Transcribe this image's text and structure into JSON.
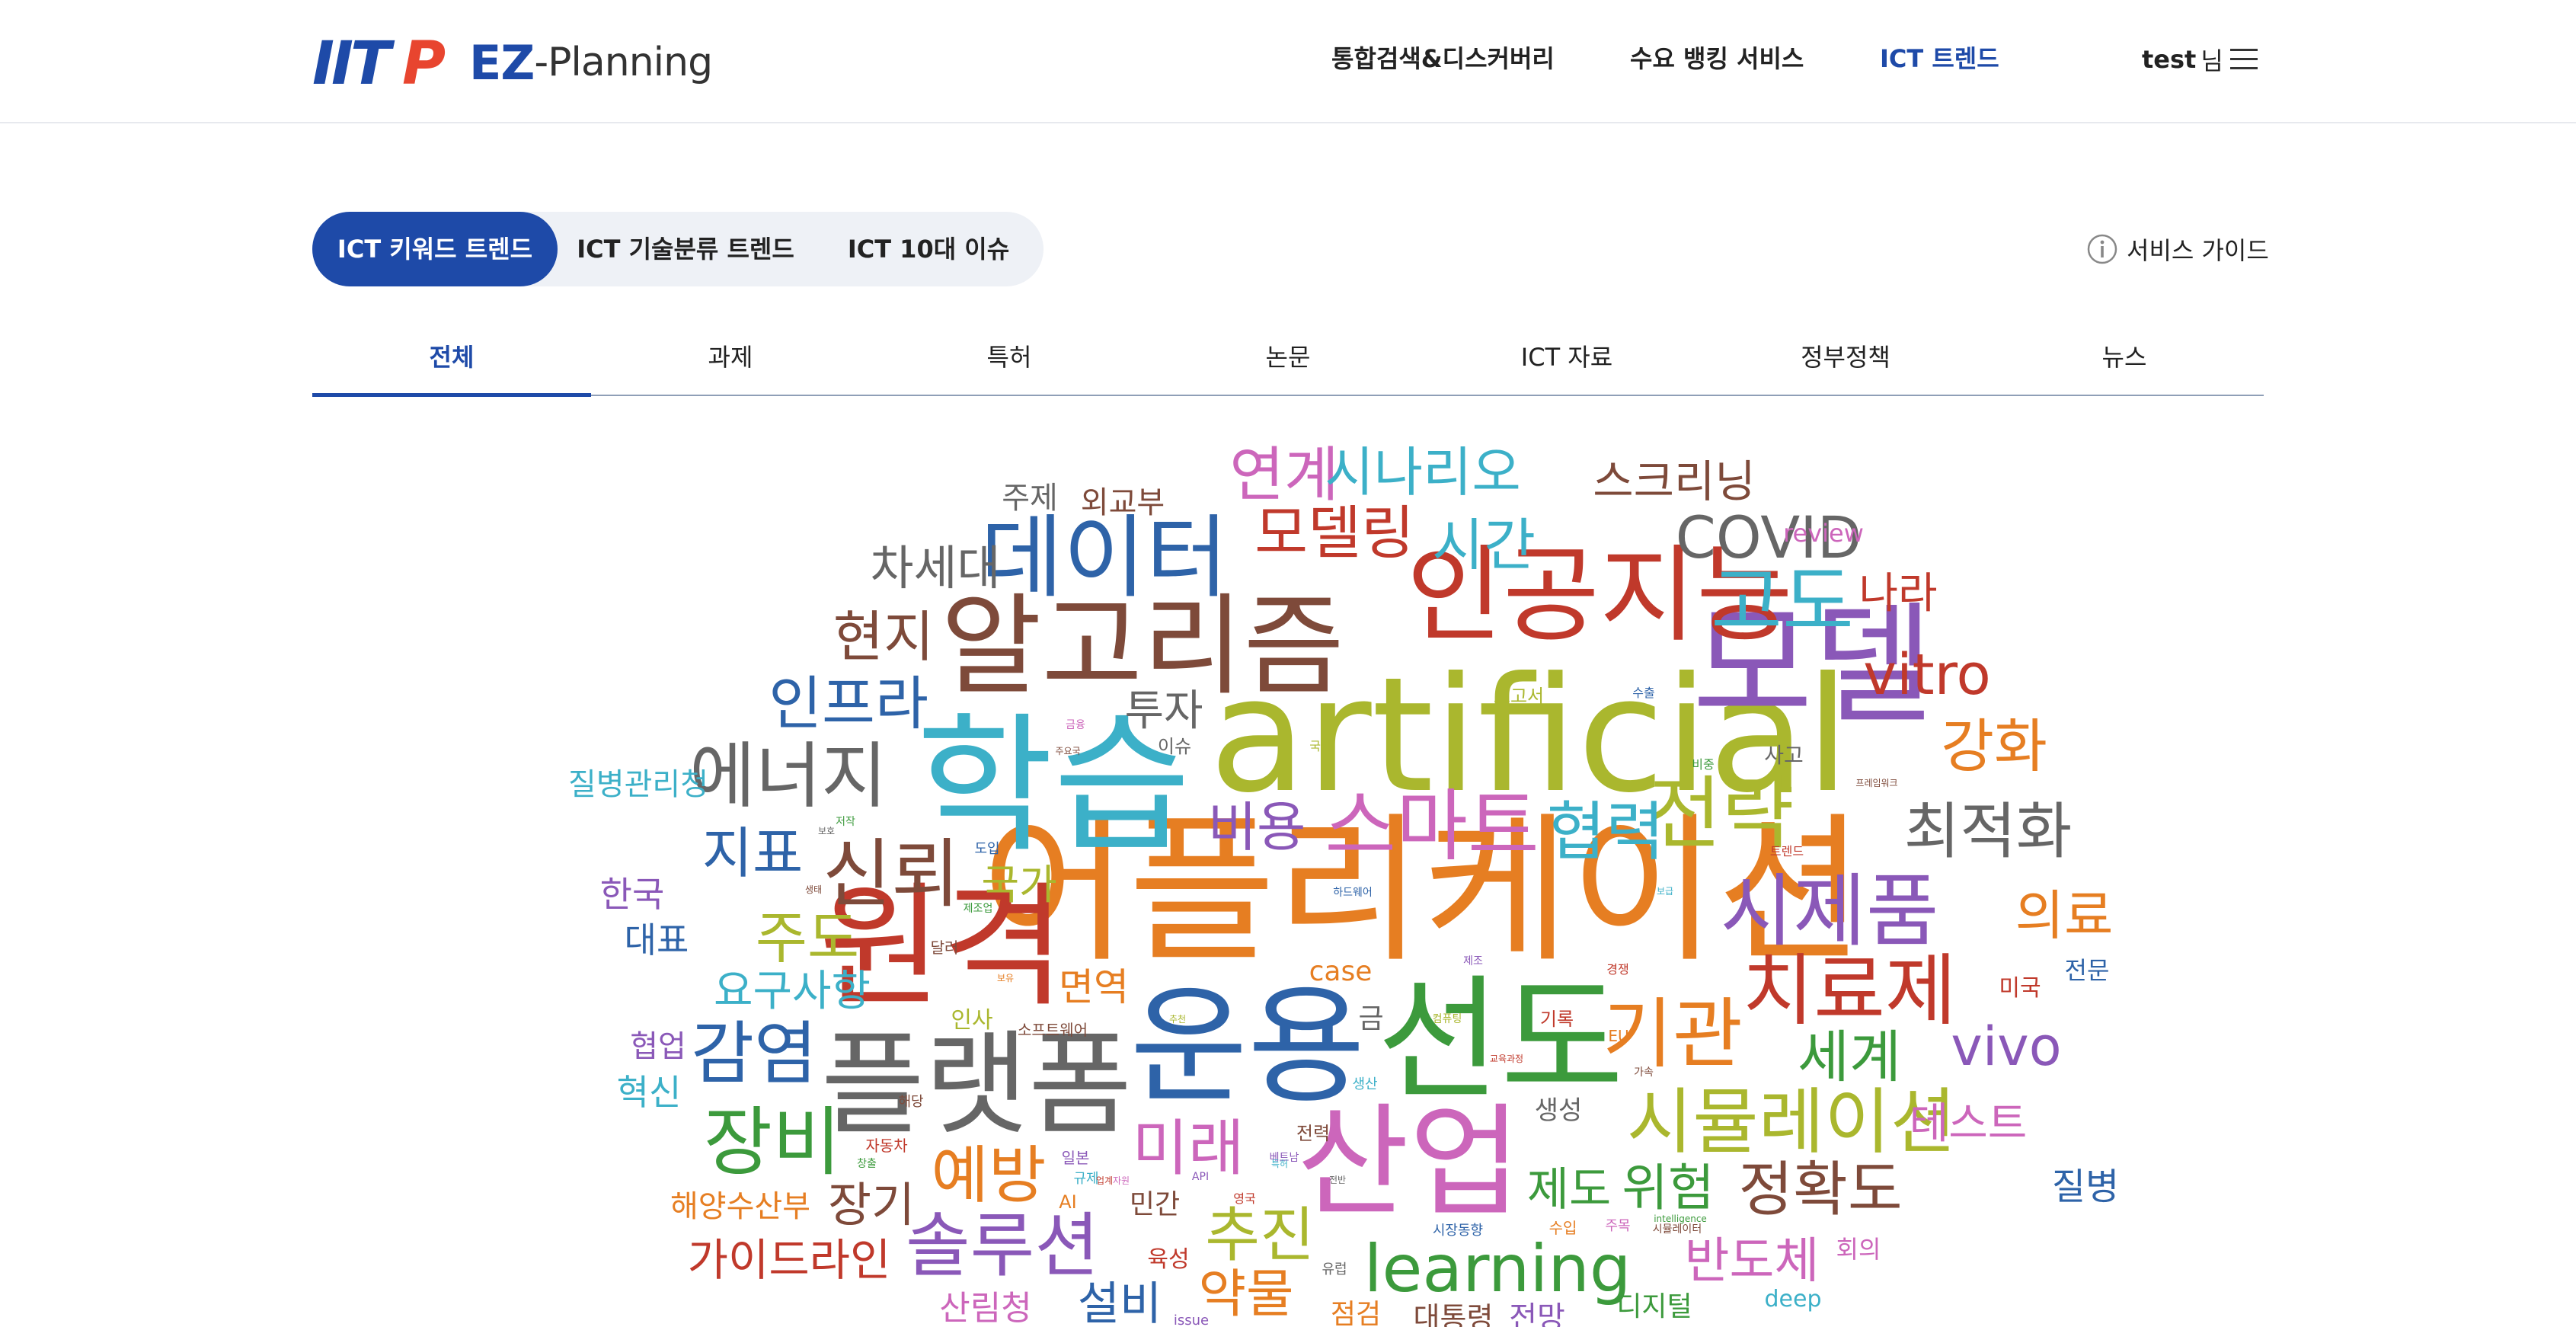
{
  "brand": {
    "logo_text": "IITP",
    "ez": "EZ",
    "planning": "-Planning",
    "primary_color": "#1e4aa8"
  },
  "nav": {
    "items": [
      "통합검색&디스커버리",
      "수요 뱅킹 서비스",
      "ICT 트렌드"
    ],
    "active_index": 2,
    "user_name": "test",
    "user_suffix": "님",
    "menu_icon": "hamburger-icon"
  },
  "trend_tabs": {
    "items": [
      "ICT 키워드 트렌드",
      "ICT 기술분류 트렌드",
      "ICT 10대 이슈"
    ],
    "active_index": 0
  },
  "service_guide": {
    "label": "서비스 가이드",
    "icon": "info-icon"
  },
  "source_tabs": {
    "items": [
      "전체",
      "과제",
      "특허",
      "논문",
      "ICT 자료",
      "정부정책",
      "뉴스"
    ],
    "active_index": 0
  },
  "word_cloud": {
    "palette": {
      "red": "#c0392b",
      "orange": "#e67e22",
      "olive": "#aab72e",
      "green": "#3c9a3c",
      "teal": "#3cb0c8",
      "blue": "#2e63a8",
      "purple": "#8a58b8",
      "pink": "#cc66bb",
      "brown": "#7e4a3a",
      "gray": "#666666"
    },
    "words": [
      {
        "text": "어플리케이션",
        "c": "orange"
      },
      {
        "text": "artificial",
        "c": "olive"
      },
      {
        "text": "학습",
        "c": "teal"
      },
      {
        "text": "원격",
        "c": "red"
      },
      {
        "text": "선도",
        "c": "green"
      },
      {
        "text": "운용",
        "c": "blue"
      },
      {
        "text": "모델",
        "c": "purple"
      },
      {
        "text": "알고리즘",
        "c": "brown"
      },
      {
        "text": "인공지능",
        "c": "red"
      },
      {
        "text": "산업",
        "c": "pink"
      },
      {
        "text": "플랫폼",
        "c": "gray"
      },
      {
        "text": "데이터",
        "c": "blue"
      },
      {
        "text": "스마트",
        "c": "pink"
      },
      {
        "text": "시제품",
        "c": "purple"
      },
      {
        "text": "치료제",
        "c": "red"
      },
      {
        "text": "전략",
        "c": "olive"
      },
      {
        "text": "기관",
        "c": "orange"
      },
      {
        "text": "에너지",
        "c": "gray"
      },
      {
        "text": "시뮬레이션",
        "c": "olive"
      },
      {
        "text": "learning",
        "c": "green"
      },
      {
        "text": "고도",
        "c": "teal"
      },
      {
        "text": "COVID",
        "c": "gray"
      },
      {
        "text": "모델링",
        "c": "red"
      },
      {
        "text": "신뢰",
        "c": "brown"
      },
      {
        "text": "장비",
        "c": "green"
      },
      {
        "text": "솔루션",
        "c": "purple"
      },
      {
        "text": "감염",
        "c": "blue"
      },
      {
        "text": "vitro",
        "c": "red"
      },
      {
        "text": "최적화",
        "c": "gray"
      },
      {
        "text": "협력",
        "c": "teal"
      },
      {
        "text": "연계",
        "c": "pink"
      },
      {
        "text": "시나리오",
        "c": "teal"
      },
      {
        "text": "시간",
        "c": "teal"
      },
      {
        "text": "인프라",
        "c": "blue"
      },
      {
        "text": "강화",
        "c": "orange"
      },
      {
        "text": "미래",
        "c": "pink"
      },
      {
        "text": "예방",
        "c": "orange"
      },
      {
        "text": "추진",
        "c": "olive"
      },
      {
        "text": "정확도",
        "c": "brown"
      },
      {
        "text": "세계",
        "c": "green"
      },
      {
        "text": "vivo",
        "c": "purple"
      },
      {
        "text": "의료",
        "c": "orange"
      },
      {
        "text": "스크리닝",
        "c": "brown"
      },
      {
        "text": "비용",
        "c": "purple"
      },
      {
        "text": "현지",
        "c": "brown"
      },
      {
        "text": "차세대",
        "c": "gray"
      },
      {
        "text": "주도",
        "c": "olive"
      },
      {
        "text": "지표",
        "c": "blue"
      },
      {
        "text": "위험",
        "c": "green"
      },
      {
        "text": "제도",
        "c": "green"
      },
      {
        "text": "반도체",
        "c": "pink"
      },
      {
        "text": "테스트",
        "c": "pink"
      },
      {
        "text": "가이드라인",
        "c": "red"
      },
      {
        "text": "장기",
        "c": "brown"
      },
      {
        "text": "약물",
        "c": "orange"
      },
      {
        "text": "투자",
        "c": "gray"
      },
      {
        "text": "나라",
        "c": "red"
      },
      {
        "text": "요구사항",
        "c": "teal"
      },
      {
        "text": "질병관리청",
        "c": "teal"
      },
      {
        "text": "질병",
        "c": "blue"
      },
      {
        "text": "설비",
        "c": "blue"
      },
      {
        "text": "면역",
        "c": "orange"
      },
      {
        "text": "국가",
        "c": "olive"
      },
      {
        "text": "한국",
        "c": "purple"
      },
      {
        "text": "대표",
        "c": "blue"
      },
      {
        "text": "혁신",
        "c": "teal"
      },
      {
        "text": "협업",
        "c": "purple"
      },
      {
        "text": "해양수산부",
        "c": "orange"
      },
      {
        "text": "산림청",
        "c": "pink"
      },
      {
        "text": "주제",
        "c": "gray"
      },
      {
        "text": "외교부",
        "c": "brown"
      },
      {
        "text": "review",
        "c": "pink"
      },
      {
        "text": "case",
        "c": "orange"
      },
      {
        "text": "생성",
        "c": "gray"
      },
      {
        "text": "민간",
        "c": "brown"
      },
      {
        "text": "전문",
        "c": "blue"
      },
      {
        "text": "미국",
        "c": "red"
      },
      {
        "text": "디지털",
        "c": "green"
      },
      {
        "text": "deep",
        "c": "teal"
      },
      {
        "text": "회의",
        "c": "pink"
      },
      {
        "text": "육성",
        "c": "red"
      },
      {
        "text": "점검",
        "c": "orange"
      },
      {
        "text": "대통령",
        "c": "brown"
      },
      {
        "text": "전망",
        "c": "purple"
      },
      {
        "text": "사고",
        "c": "gray"
      },
      {
        "text": "인사",
        "c": "olive"
      },
      {
        "text": "금",
        "c": "gray"
      },
      {
        "text": "보고서",
        "c": "olive"
      },
      {
        "text": "기록",
        "c": "red"
      },
      {
        "text": "이슈",
        "c": "gray"
      },
      {
        "text": "전력",
        "c": "brown"
      },
      {
        "text": "자동차",
        "c": "red"
      },
      {
        "text": "AI",
        "c": "orange"
      },
      {
        "text": "일본",
        "c": "purple"
      },
      {
        "text": "규제",
        "c": "teal"
      },
      {
        "text": "유럽",
        "c": "gray"
      },
      {
        "text": "달러",
        "c": "brown"
      },
      {
        "text": "도입",
        "c": "blue"
      },
      {
        "text": "소프트웨어",
        "c": "brown"
      },
      {
        "text": "해당",
        "c": "brown"
      },
      {
        "text": "EU",
        "c": "orange"
      },
      {
        "text": "생산",
        "c": "teal"
      },
      {
        "text": "주목",
        "c": "pink"
      },
      {
        "text": "시장동향",
        "c": "blue"
      },
      {
        "text": "수입",
        "c": "orange"
      },
      {
        "text": "issue",
        "c": "purple"
      },
      {
        "text": "영국",
        "c": "red"
      },
      {
        "text": "API",
        "c": "purple"
      },
      {
        "text": "가속",
        "c": "brown"
      },
      {
        "text": "국제",
        "c": "olive"
      },
      {
        "text": "비중",
        "c": "green"
      },
      {
        "text": "트렌드",
        "c": "red"
      },
      {
        "text": "프레임워크",
        "c": "brown"
      },
      {
        "text": "수출",
        "c": "blue"
      },
      {
        "text": "주요국",
        "c": "brown"
      },
      {
        "text": "저작",
        "c": "green"
      },
      {
        "text": "보호",
        "c": "gray"
      },
      {
        "text": "경쟁",
        "c": "red"
      },
      {
        "text": "제조",
        "c": "purple"
      },
      {
        "text": "제조업",
        "c": "green"
      },
      {
        "text": "하드웨어",
        "c": "blue"
      },
      {
        "text": "보급",
        "c": "teal"
      },
      {
        "text": "창출",
        "c": "green"
      },
      {
        "text": "업계",
        "c": "red"
      },
      {
        "text": "자원",
        "c": "pink"
      },
      {
        "text": "베트남",
        "c": "purple"
      },
      {
        "text": "특허",
        "c": "teal"
      },
      {
        "text": "추천",
        "c": "olive"
      },
      {
        "text": "전반",
        "c": "gray"
      },
      {
        "text": "시뮬레이터",
        "c": "brown"
      },
      {
        "text": "금융",
        "c": "pink"
      },
      {
        "text": "보유",
        "c": "orange"
      },
      {
        "text": "컴퓨팅",
        "c": "olive"
      },
      {
        "text": "생태",
        "c": "brown"
      },
      {
        "text": "intelligence",
        "c": "green"
      },
      {
        "text": "교육과정",
        "c": "red"
      }
    ]
  }
}
